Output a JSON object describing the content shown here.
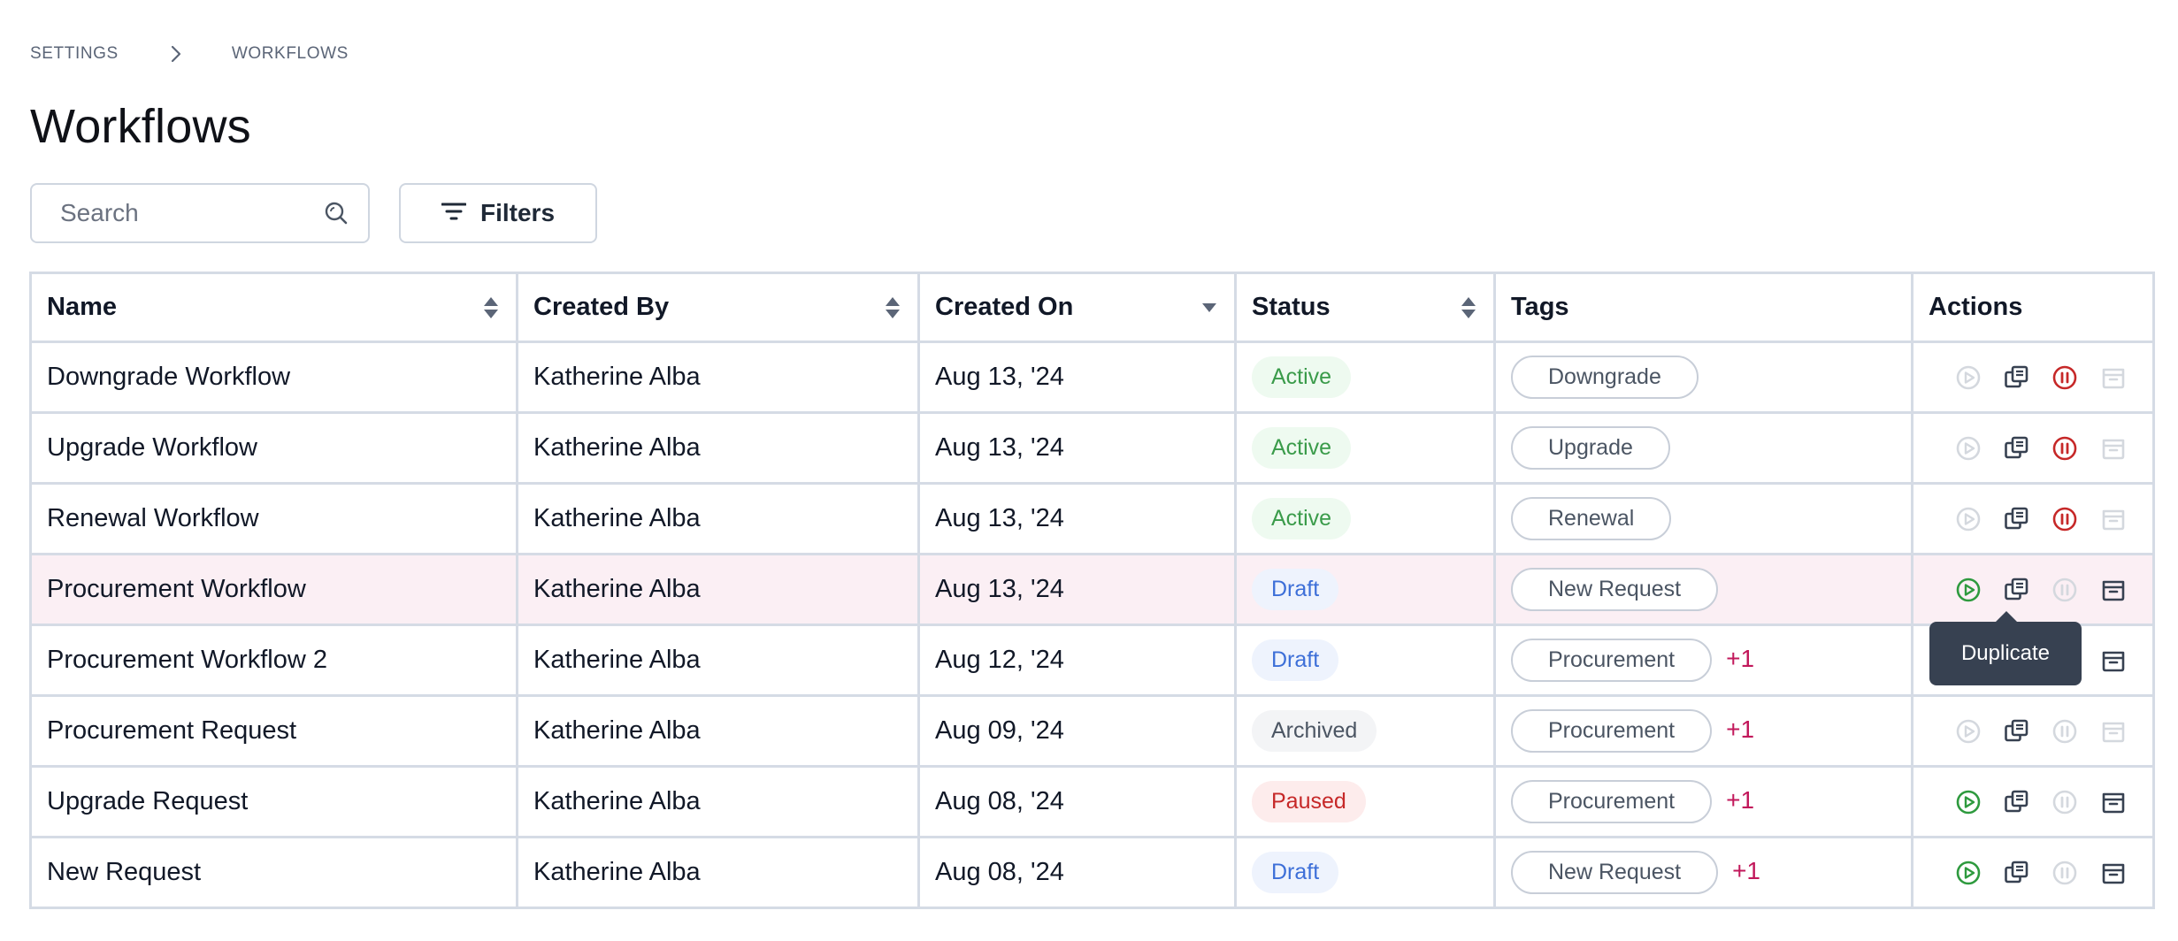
{
  "breadcrumb": {
    "items": [
      "SETTINGS",
      "WORKFLOWS"
    ]
  },
  "page": {
    "title": "Workflows"
  },
  "search": {
    "placeholder": "Search",
    "value": ""
  },
  "toolbar": {
    "filters_label": "Filters"
  },
  "table": {
    "columns": [
      "Name",
      "Created By",
      "Created On",
      "Status",
      "Tags",
      "Actions"
    ],
    "rows": [
      {
        "name": "Downgrade Workflow",
        "created_by": "Katherine Alba",
        "created_on": "Aug 13, '24",
        "status": "Active",
        "tag": "Downgrade",
        "tag_more": ""
      },
      {
        "name": "Upgrade Workflow",
        "created_by": "Katherine Alba",
        "created_on": "Aug 13, '24",
        "status": "Active",
        "tag": "Upgrade",
        "tag_more": ""
      },
      {
        "name": "Renewal Workflow",
        "created_by": "Katherine Alba",
        "created_on": "Aug 13, '24",
        "status": "Active",
        "tag": "Renewal",
        "tag_more": ""
      },
      {
        "name": "Procurement Workflow",
        "created_by": "Katherine Alba",
        "created_on": "Aug 13, '24",
        "status": "Draft",
        "tag": "New Request",
        "tag_more": ""
      },
      {
        "name": "Procurement Workflow 2",
        "created_by": "Katherine Alba",
        "created_on": "Aug 12, '24",
        "status": "Draft",
        "tag": "Procurement",
        "tag_more": "+1"
      },
      {
        "name": "Procurement Request",
        "created_by": "Katherine Alba",
        "created_on": "Aug 09, '24",
        "status": "Archived",
        "tag": "Procurement",
        "tag_more": "+1"
      },
      {
        "name": "Upgrade Request",
        "created_by": "Katherine Alba",
        "created_on": "Aug 08, '24",
        "status": "Paused",
        "tag": "Procurement",
        "tag_more": "+1"
      },
      {
        "name": "New Request",
        "created_by": "Katherine Alba",
        "created_on": "Aug 08, '24",
        "status": "Draft",
        "tag": "New Request",
        "tag_more": "+1"
      }
    ]
  },
  "tooltip": {
    "text": "Duplicate"
  },
  "icons": {
    "breadcrumb_separator": "chevron-right-icon",
    "search": "search-icon",
    "filters": "filter-lines-icon",
    "sort_both": "sort-updown-icon",
    "sort_desc": "caret-down-icon",
    "actions": [
      "play-circle-icon",
      "duplicate-icon",
      "pause-circle-icon",
      "archive-icon"
    ]
  },
  "colors": {
    "active_text": "#3a9b4a",
    "active_bg": "#eefaf0",
    "draft_text": "#3d6fd8",
    "draft_bg": "#eef3fd",
    "archived_text": "#4b5563",
    "archived_bg": "#f3f4f6",
    "paused_text": "#c62828",
    "paused_bg": "#fdecec",
    "tag_more": "#c2185b",
    "highlight_row": "#fbeff4",
    "play_enabled": "#2e9a3e",
    "pause_enabled": "#c62828",
    "icon_dark": "#374151",
    "icon_disabled": "#d4d8de",
    "tooltip_bg": "#374151"
  }
}
